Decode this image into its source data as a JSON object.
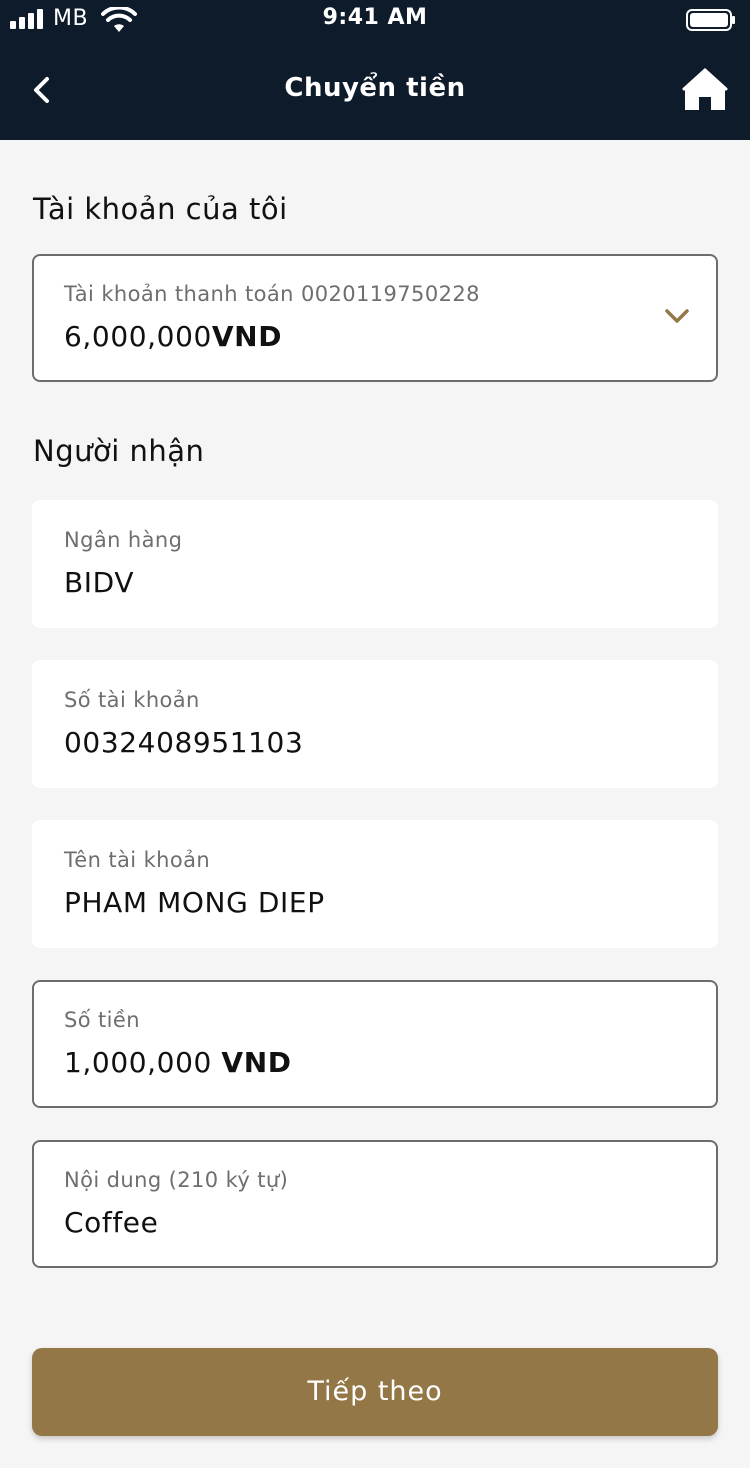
{
  "status_bar": {
    "carrier": "MB",
    "time": "9:41 AM"
  },
  "header": {
    "title": "Chuyển tiền",
    "icons": [
      "chevron-left-icon",
      "home-icon"
    ]
  },
  "my_account": {
    "section_title": "Tài khoản của tôi",
    "account_label": "Tài khoản thanh toán 0020119750228",
    "balance_amount": "6,000,000",
    "balance_currency": "VND"
  },
  "recipient": {
    "section_title": "Người nhận",
    "bank_label": "Ngân hàng",
    "bank_value": "BIDV",
    "account_number_label": "Số tài khoản",
    "account_number_value": "0032408951103",
    "account_name_label": "Tên tài khoản",
    "account_name_value": "PHAM MONG DIEP",
    "amount_label": "Số tiền",
    "amount_value": "1,000,000",
    "amount_currency": "VND",
    "note_label": "Nội dung (210 ký tự)",
    "note_value": "Coffee"
  },
  "actions": {
    "next_label": "Tiếp theo"
  },
  "colors": {
    "header_bg": "#0e1b2b",
    "accent": "#947747",
    "page_bg": "#f5f5f5"
  }
}
